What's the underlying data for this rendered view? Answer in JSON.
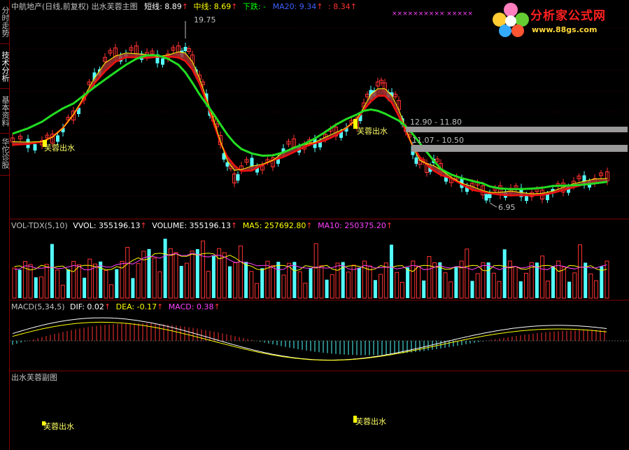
{
  "colors": {
    "up": "#ff3232",
    "down": "#54ffff",
    "grid": "#800000",
    "ma_green": "#22dd22",
    "ma_red": "#ee1111",
    "band": "#a03030",
    "white_line": "#ffffff",
    "yellow_line": "#ffff00",
    "magenta": "#ff40ff",
    "gray_bar": "#9a9a9a",
    "label_text": "#c0c0c0"
  },
  "side_tabs": [
    {
      "label": "分时走势",
      "icon": "tab"
    },
    {
      "label": "技术分析",
      "icon": "tab"
    },
    {
      "label": "基本资料",
      "icon": "tab"
    },
    {
      "label": "华佗诊股",
      "icon": "tab"
    }
  ],
  "main_header": {
    "title": "中航地产(日线,前复权) 出水芙蓉主图",
    "short_label": "短线: 8.89",
    "short_color": "#ffffff",
    "mid_label": "中线: 8.69",
    "mid_color": "#ffff00",
    "down_label": "下跌: -",
    "down_color": "#00ff00",
    "ma20_label": "MA20: 9.34",
    "ma20_color": "#4060ff",
    "extra_label": ": 8.34",
    "extra_color": "#ff3232",
    "arrow": "↑"
  },
  "vol_header": {
    "name": "VOL-TDX(5,10)",
    "vvol": "VVOL: 355196.13",
    "volume": "VOLUME: 355196.13",
    "ma5": "MA5: 257692.80",
    "ma10": "MA10: 250375.20",
    "arrow": "↑"
  },
  "macd_header": {
    "name": "MACD(5,34,5)",
    "dif": "DIF: 0.02",
    "dea": "DEA: -0.17",
    "macd": "MACD: 0.38",
    "arrow": "↑"
  },
  "sub_header": {
    "name": "出水芙蓉副图"
  },
  "price_marks": {
    "high": "19.75",
    "low": "6.95",
    "range1": "12.90 - 11.80",
    "range2": "11.07 - 10.50"
  },
  "signals": {
    "main_left": "芙蓉出水",
    "main_right": "芙蓉出水",
    "sub_left": "芙蓉出水",
    "sub_right": "芙蓉出水"
  },
  "logo": {
    "title": "分析家公式网",
    "url": "www.88gs.com"
  },
  "decoration": "××××××××××  ×××××"
}
